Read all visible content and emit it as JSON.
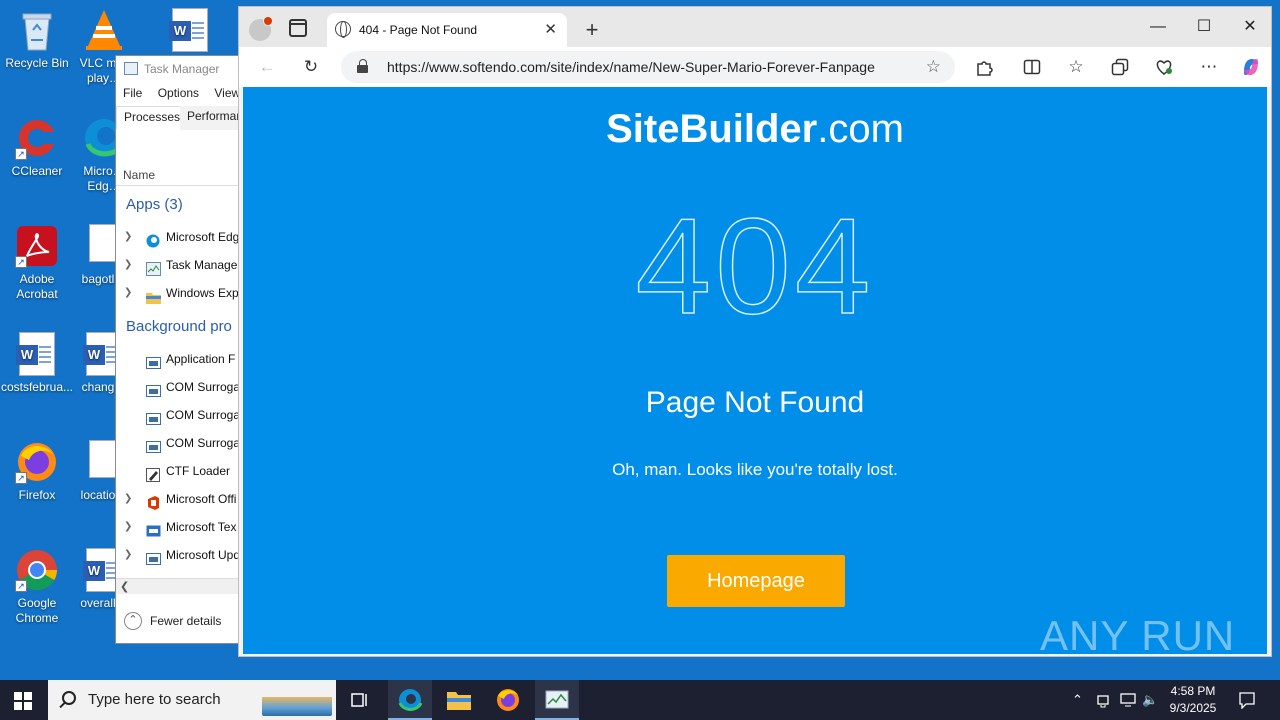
{
  "desktop": {
    "icons": [
      {
        "label": "Recycle Bin",
        "icon": "recycle-bin-icon"
      },
      {
        "label": "VLC m… play…",
        "icon": "vlc-icon"
      },
      {
        "label": "CCleaner",
        "icon": "ccleaner-icon"
      },
      {
        "label": "Micro… Edg…",
        "icon": "edge-icon"
      },
      {
        "label": "Adobe Acrobat",
        "icon": "acrobat-icon"
      },
      {
        "label": "bagotl…",
        "icon": "image-file-icon"
      },
      {
        "label": "costsfebrua...",
        "icon": "word-doc-icon"
      },
      {
        "label": "chang…",
        "icon": "word-doc-icon"
      },
      {
        "label": "Firefox",
        "icon": "firefox-icon"
      },
      {
        "label": "locatio…",
        "icon": "image-file-icon"
      },
      {
        "label": "Google Chrome",
        "icon": "chrome-icon"
      },
      {
        "label": "overall…",
        "icon": "word-doc-icon"
      }
    ]
  },
  "task_manager": {
    "title": "Task Manager",
    "menu": [
      "File",
      "Options",
      "View"
    ],
    "tabs": [
      "Processes",
      "Performan"
    ],
    "column_name": "Name",
    "apps_group": "Apps (3)",
    "apps": [
      "Microsoft Edg",
      "Task Manager",
      "Windows Exp"
    ],
    "background_group": "Background pro",
    "background": [
      "Application F",
      "COM Surroga",
      "COM Surroga",
      "COM Surroga",
      "CTF Loader",
      "Microsoft Offi",
      "Microsoft Tex",
      "Microsoft Upd"
    ],
    "fewer_details": "Fewer details"
  },
  "browser": {
    "tab_title": "404 - Page Not Found",
    "new_tab_symbol": "+",
    "close_tab_symbol": "✕",
    "url": "https://www.softendo.com/site/index/name/New-Super-Mario-Forever-Fanpage",
    "window_controls": {
      "minimize": "—",
      "maximize": "☐",
      "close": "✕"
    }
  },
  "page": {
    "brand_bold": "SiteBuilder",
    "brand_rest": ".com",
    "code": "404",
    "heading": "Page Not Found",
    "subtitle": "Oh, man. Looks like you're totally lost.",
    "button": "Homepage",
    "watermark": "ANY RUN"
  },
  "taskbar": {
    "search_placeholder": "Type here to search",
    "time": "4:58 PM",
    "date": "9/3/2025"
  },
  "colors": {
    "page_bg": "#008ee8",
    "button_bg": "#f9a900",
    "desktop_bg": "#1273c8",
    "taskbar_bg": "#1c2030"
  }
}
